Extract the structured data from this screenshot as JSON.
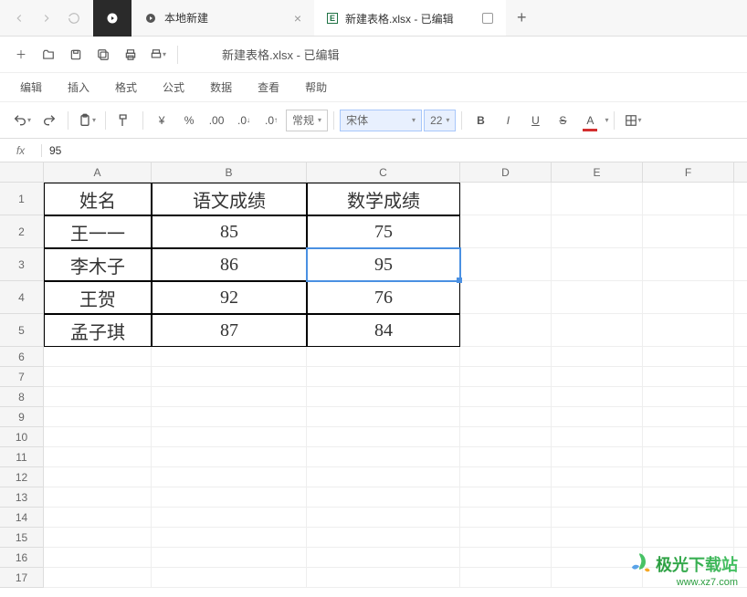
{
  "tabs": {
    "tab1_label": "本地新建",
    "tab2_label": "新建表格.xlsx - 已编辑"
  },
  "doc_title": "新建表格.xlsx - 已编辑",
  "menu": {
    "edit": "编辑",
    "insert": "插入",
    "format": "格式",
    "formula": "公式",
    "data": "数据",
    "view": "查看",
    "help": "帮助"
  },
  "toolbar2": {
    "currency": "¥",
    "percent": "%",
    "dec_inc": ".0",
    "dec_dec": ".0",
    "num_format": "常规",
    "font_name": "宋体",
    "font_size": "22",
    "bold": "B",
    "italic": "I",
    "underline": "U",
    "strike": "S",
    "font_color": "A"
  },
  "formula": {
    "fx": "fx",
    "value": "95"
  },
  "columns": [
    "A",
    "B",
    "C",
    "D",
    "E",
    "F"
  ],
  "rows": [
    "1",
    "2",
    "3",
    "4",
    "5",
    "6",
    "7",
    "8",
    "9",
    "10",
    "11",
    "12",
    "13",
    "14",
    "15",
    "16",
    "17"
  ],
  "table": {
    "headers": {
      "name": "姓名",
      "chinese": "语文成绩",
      "math": "数学成绩"
    },
    "rows": [
      {
        "name": "王一一",
        "chinese": "85",
        "math": "75"
      },
      {
        "name": "李木子",
        "chinese": "86",
        "math": "95"
      },
      {
        "name": "王贺",
        "chinese": "92",
        "math": "76"
      },
      {
        "name": "孟子琪",
        "chinese": "87",
        "math": "84"
      }
    ]
  },
  "selected_cell": "C3",
  "watermark": {
    "brand": "极光下载站",
    "url": "www.xz7.com"
  }
}
